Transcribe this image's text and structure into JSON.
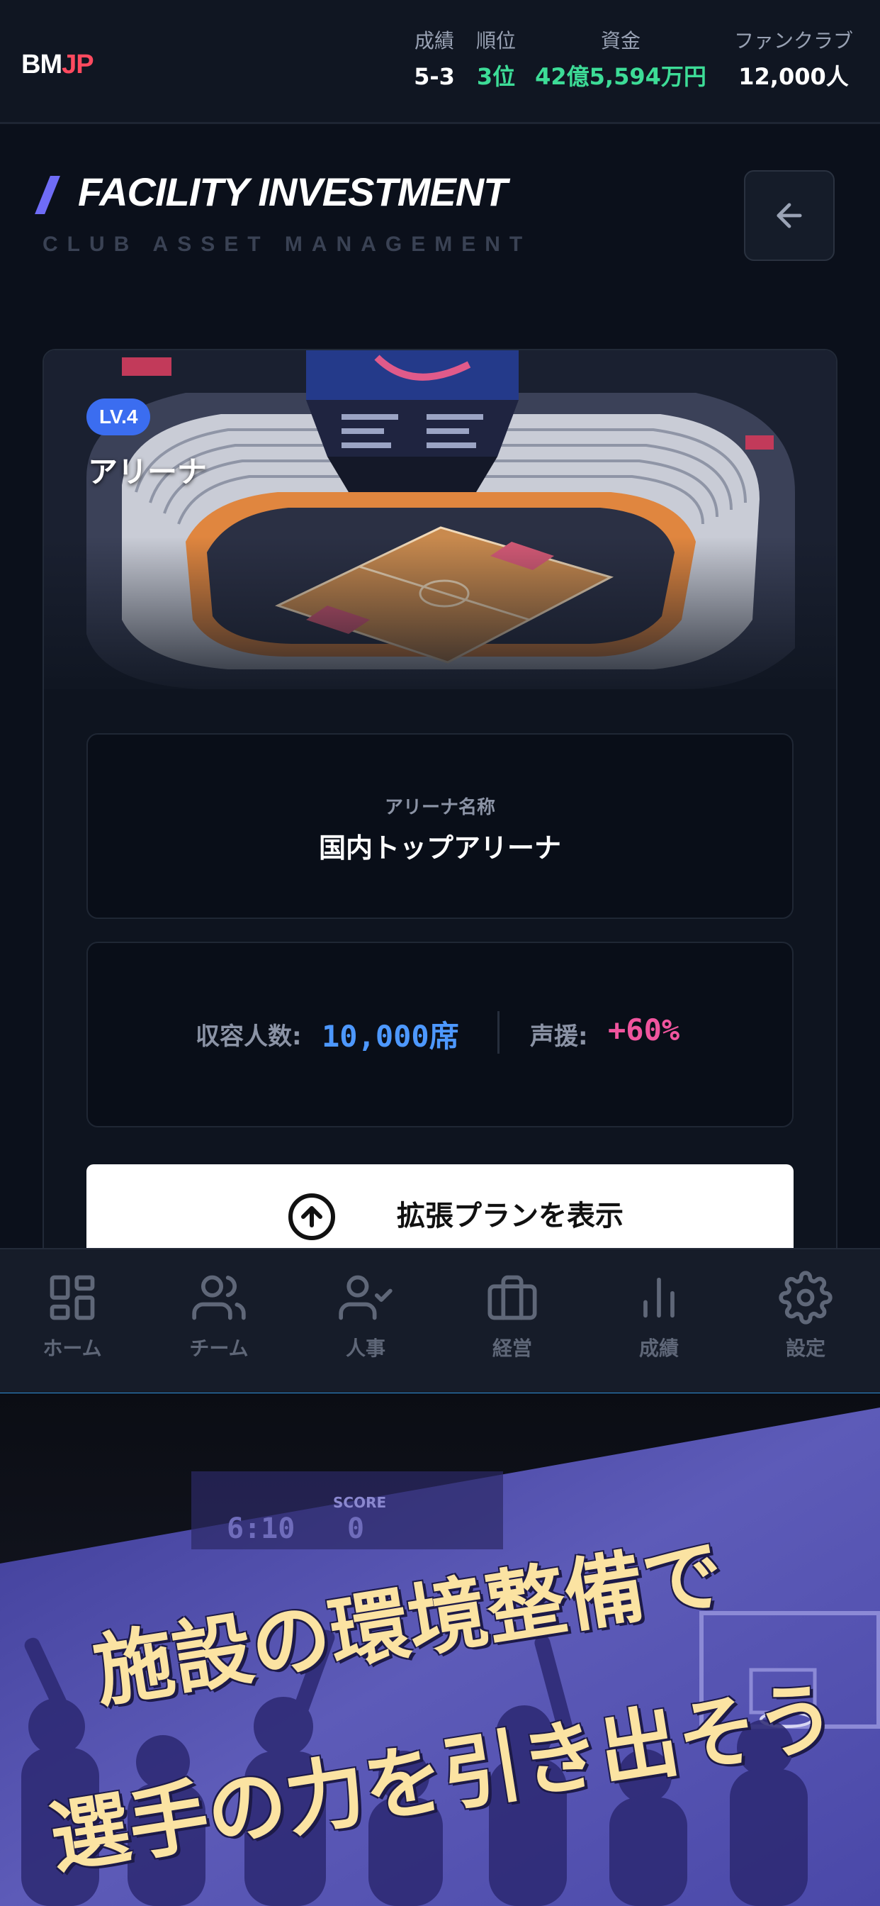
{
  "header": {
    "logo_left": "BM",
    "logo_right": "JP",
    "stats": [
      {
        "label": "成績",
        "value": "5-3",
        "color": "#ffffff"
      },
      {
        "label": "順位",
        "value": "3位",
        "color": "#3ddc97"
      },
      {
        "label": "資金",
        "value": "42億5,594万円",
        "color": "#3ddc97"
      },
      {
        "label": "ファンクラブ",
        "value": "12,000人",
        "color": "#ffffff"
      }
    ]
  },
  "page": {
    "title": "FACILITY INVESTMENT",
    "subtitle": "CLUB ASSET MANAGEMENT",
    "back_icon": "arrow-left-icon"
  },
  "facility": {
    "level": "LV.4",
    "name": "アリーナ",
    "arena_name_label": "アリーナ名称",
    "arena_name": "国内トップアリーナ",
    "capacity_label": "収容人数:",
    "capacity_value": "10,000席",
    "support_label": "声援:",
    "support_value": "+60%",
    "expand_button": "拡張プランを表示",
    "expand_icon": "arrow-up-circle-icon"
  },
  "nav": {
    "items": [
      {
        "label": "ホーム",
        "icon": "home-grid-icon"
      },
      {
        "label": "チーム",
        "icon": "users-icon"
      },
      {
        "label": "人事",
        "icon": "user-check-icon"
      },
      {
        "label": "経営",
        "icon": "briefcase-icon"
      },
      {
        "label": "成績",
        "icon": "bar-chart-icon"
      },
      {
        "label": "設定",
        "icon": "gear-icon"
      }
    ]
  },
  "promo": {
    "line1": "施設の環境整備で",
    "line2": "選手の力を引き出そう",
    "scoreboard_label": "SCORE",
    "scoreboard_time": "6:10",
    "scoreboard_score": "0"
  },
  "colors": {
    "accent": "#6f6cf6",
    "capacity": "#4d98ff",
    "support": "#f0559e",
    "positive": "#3ddc97",
    "logo_red": "#ff4a5f"
  }
}
